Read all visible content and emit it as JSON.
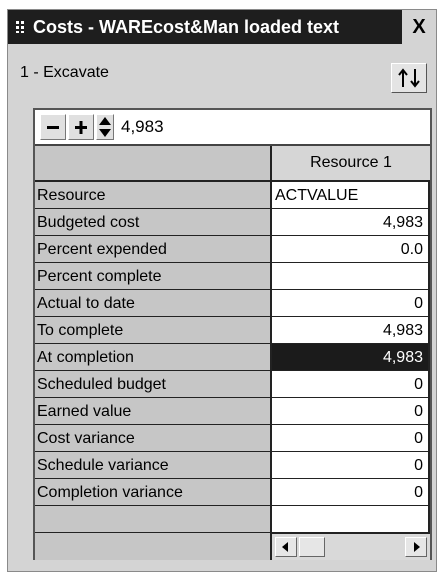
{
  "window": {
    "title": "Costs - WAREcost&Man loaded text",
    "close_label": "X"
  },
  "activity": {
    "label": "1 - Excavate"
  },
  "toolbar": {
    "minus_label": "−",
    "plus_label": "+",
    "value": "4,983"
  },
  "grid": {
    "column_header": "Resource 1",
    "rows": [
      {
        "label": "Resource",
        "value": "ACTVALUE"
      },
      {
        "label": "Budgeted cost",
        "value": "4,983"
      },
      {
        "label": "Percent expended",
        "value": "0.0"
      },
      {
        "label": "Percent complete",
        "value": ""
      },
      {
        "label": "Actual to date",
        "value": "0"
      },
      {
        "label": "To complete",
        "value": "4,983"
      },
      {
        "label": "At completion",
        "value": "4,983",
        "selected": true
      },
      {
        "label": "Scheduled budget",
        "value": "0"
      },
      {
        "label": "Earned value",
        "value": "0"
      },
      {
        "label": "Cost variance",
        "value": "0"
      },
      {
        "label": "Schedule variance",
        "value": "0"
      },
      {
        "label": "Completion variance",
        "value": "0"
      },
      {
        "label": "",
        "value": ""
      }
    ]
  },
  "icons": {
    "grip": "grip-icon",
    "sort": "sort-up-down-icon",
    "spin": "spin-up-down-icon",
    "scroll_left": "arrow-left-icon",
    "scroll_right": "arrow-right-icon"
  }
}
